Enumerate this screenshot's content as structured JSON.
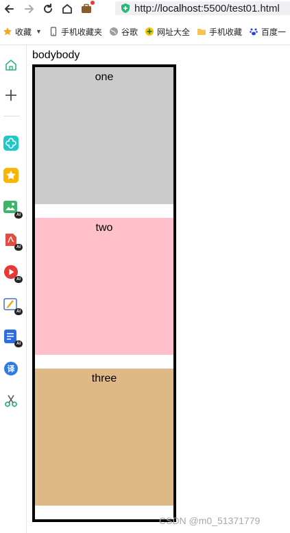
{
  "browser": {
    "url_prefix": "http://",
    "url_host": "localhost",
    "url_rest": ":5500/test01.html"
  },
  "bookmarks": [
    {
      "label": "收藏",
      "icon": "star-icon"
    },
    {
      "label": "手机收藏夹",
      "icon": "phone-icon"
    },
    {
      "label": "谷歌",
      "icon": "globe-icon"
    },
    {
      "label": "网址大全",
      "icon": "plus-circle-icon"
    },
    {
      "label": "手机收藏",
      "icon": "folder-icon"
    },
    {
      "label": "百度一",
      "icon": "paw-icon"
    }
  ],
  "page": {
    "body_text": "bodybody",
    "boxes": [
      {
        "label": "one",
        "color": "#cbcbcb"
      },
      {
        "label": "two",
        "color": "#ffc0cb"
      },
      {
        "label": "three",
        "color": "#deb887"
      }
    ]
  },
  "sidebar": {
    "ai_badge": "AI"
  },
  "watermark": "CSDN @m0_51371779"
}
